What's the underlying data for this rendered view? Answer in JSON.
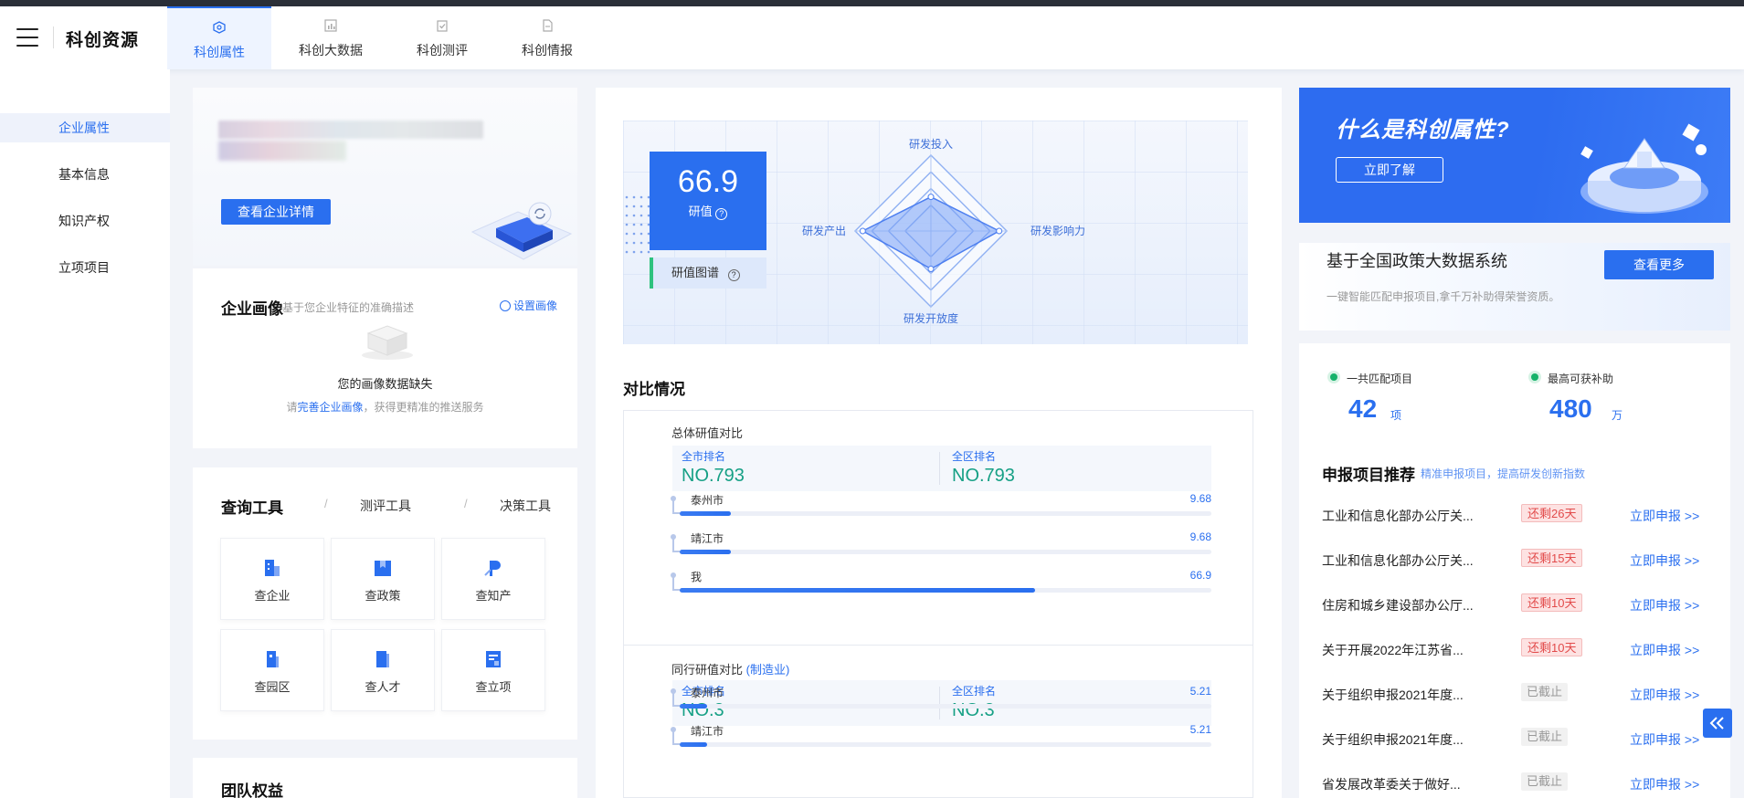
{
  "header": {
    "brand": "科创资源",
    "tabs": [
      {
        "label": "科创属性",
        "icon": "cube-icon",
        "active": true
      },
      {
        "label": "科创大数据",
        "icon": "bar-chart-icon",
        "active": false
      },
      {
        "label": "科创测评",
        "icon": "clipboard-check-icon",
        "active": false
      },
      {
        "label": "科创情报",
        "icon": "document-icon",
        "active": false
      }
    ]
  },
  "sidebar": {
    "items": [
      {
        "label": "企业属性",
        "active": true
      },
      {
        "label": "基本信息",
        "active": false
      },
      {
        "label": "知识产权",
        "active": false
      },
      {
        "label": "立项项目",
        "active": false
      }
    ]
  },
  "company": {
    "detail_button": "查看企业详情"
  },
  "portrait": {
    "title": "企业画像",
    "subtitle": "基于您企业特征的准确描述",
    "setting_link": "设置画像",
    "empty_text": "您的画像数据缺失",
    "hint_prefix": "请",
    "hint_link": "完善企业画像",
    "hint_suffix": "，获得更精准的推送服务"
  },
  "tools": {
    "tabs": [
      "查询工具",
      "测评工具",
      "决策工具"
    ],
    "separator": "/",
    "items": [
      {
        "label": "查企业",
        "icon": "enterprise-icon"
      },
      {
        "label": "查政策",
        "icon": "policy-book-icon"
      },
      {
        "label": "查知产",
        "icon": "ip-icon"
      },
      {
        "label": "查园区",
        "icon": "park-icon"
      },
      {
        "label": "查人才",
        "icon": "talent-icon"
      },
      {
        "label": "查立项",
        "icon": "project-icon"
      }
    ]
  },
  "team": {
    "title": "团队权益"
  },
  "score": {
    "value": "66.9",
    "label": "研值",
    "spectrum_label": "研值图谱",
    "radar_axes": [
      "研发投入",
      "研发影响力",
      "研发开放度",
      "研发产出"
    ],
    "radar_values": [
      0.45,
      0.9,
      0.5,
      0.9
    ]
  },
  "compare": {
    "title": "对比情况",
    "groups": [
      {
        "title": "总体研值对比",
        "title_link": "",
        "city_rank_label": "全市排名",
        "city_rank": "NO.793",
        "district_rank_label": "全区排名",
        "district_rank": "NO.793",
        "bars": [
          {
            "name": "泰州市",
            "value": "9.68",
            "fraction": 0.097
          },
          {
            "name": "靖江市",
            "value": "9.68",
            "fraction": 0.097
          },
          {
            "name": "我",
            "value": "66.9",
            "fraction": 0.669
          }
        ]
      },
      {
        "title": "同行研值对比",
        "title_link": "(制造业)",
        "city_rank_label": "全市排名",
        "city_rank": "NO.3",
        "district_rank_label": "全区排名",
        "district_rank": "NO.3",
        "bars": [
          {
            "name": "泰州市",
            "value": "5.21",
            "fraction": 0.052
          },
          {
            "name": "靖江市",
            "value": "5.21",
            "fraction": 0.052
          }
        ]
      }
    ]
  },
  "promo": {
    "banner_title": "什么是科创属性?",
    "banner_button": "立即了解",
    "system_title": "基于全国政策大数据系统",
    "system_button": "查看更多",
    "system_desc": "一键智能匹配申报项目,拿千万补助得荣誉资质。",
    "stats": [
      {
        "label": "一共匹配项目",
        "value": "42",
        "unit": "项"
      },
      {
        "label": "最高可获补助",
        "value": "480",
        "unit": "万"
      }
    ]
  },
  "recommend": {
    "title": "申报项目推荐",
    "subtitle": "精准申报项目，提高研发创新指数",
    "items": [
      {
        "title": "工业和信息化部办公厅关...",
        "badge": "还剩26天",
        "status": "warn",
        "action": "立即申报 >>"
      },
      {
        "title": "工业和信息化部办公厅关...",
        "badge": "还剩15天",
        "status": "warn",
        "action": "立即申报 >>"
      },
      {
        "title": "住房和城乡建设部办公厅...",
        "badge": "还剩10天",
        "status": "warn",
        "action": "立即申报 >>"
      },
      {
        "title": "关于开展2022年江苏省...",
        "badge": "还剩10天",
        "status": "warn",
        "action": "立即申报 >>"
      },
      {
        "title": "关于组织申报2021年度...",
        "badge": "已截止",
        "status": "off",
        "action": "立即申报 >>"
      },
      {
        "title": "关于组织申报2021年度...",
        "badge": "已截止",
        "status": "off",
        "action": "立即申报 >>"
      },
      {
        "title": "省发展改革委关于做好...",
        "badge": "已截止",
        "status": "off",
        "action": "立即申报 >>"
      }
    ]
  },
  "colors": {
    "accent": "#2a6fef",
    "rank_green": "#16a085",
    "warn_red": "#e24b4b"
  }
}
